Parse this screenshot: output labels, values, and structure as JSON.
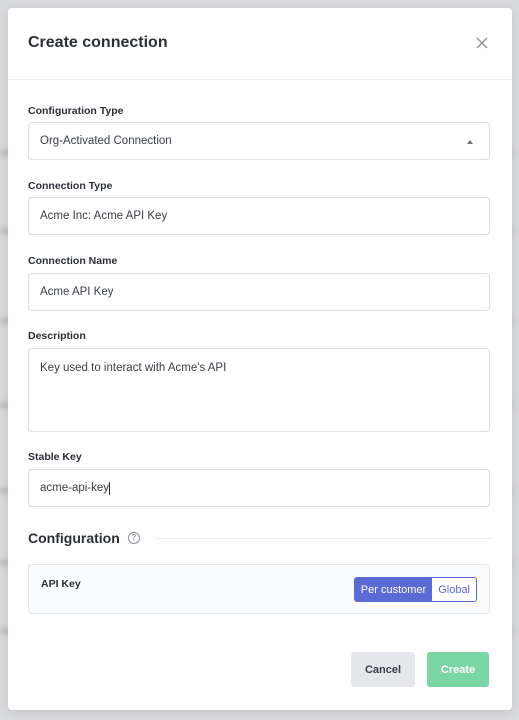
{
  "modal": {
    "title": "Create connection",
    "close_icon": "close-icon"
  },
  "fields": {
    "configuration_type": {
      "label": "Configuration Type",
      "value": "Org-Activated Connection"
    },
    "connection_type": {
      "label": "Connection Type",
      "value": "Acme Inc: Acme API Key"
    },
    "connection_name": {
      "label": "Connection Name",
      "value": "Acme API Key"
    },
    "description": {
      "label": "Description",
      "value": "Key used to interact with Acme's API"
    },
    "stable_key": {
      "label": "Stable Key",
      "value": "acme-api-key"
    }
  },
  "configuration": {
    "title": "Configuration",
    "help_icon": "question-circle-icon",
    "api_key_label": "API Key",
    "options": [
      "Per customer",
      "Global"
    ],
    "selected": "Per customer"
  },
  "actions": {
    "cancel_label": "Cancel",
    "create_label": "Create"
  },
  "colors": {
    "accent": "#5b6bd6",
    "create_button": "#7bd6a6",
    "cancel_button": "#e5e7ea"
  }
}
